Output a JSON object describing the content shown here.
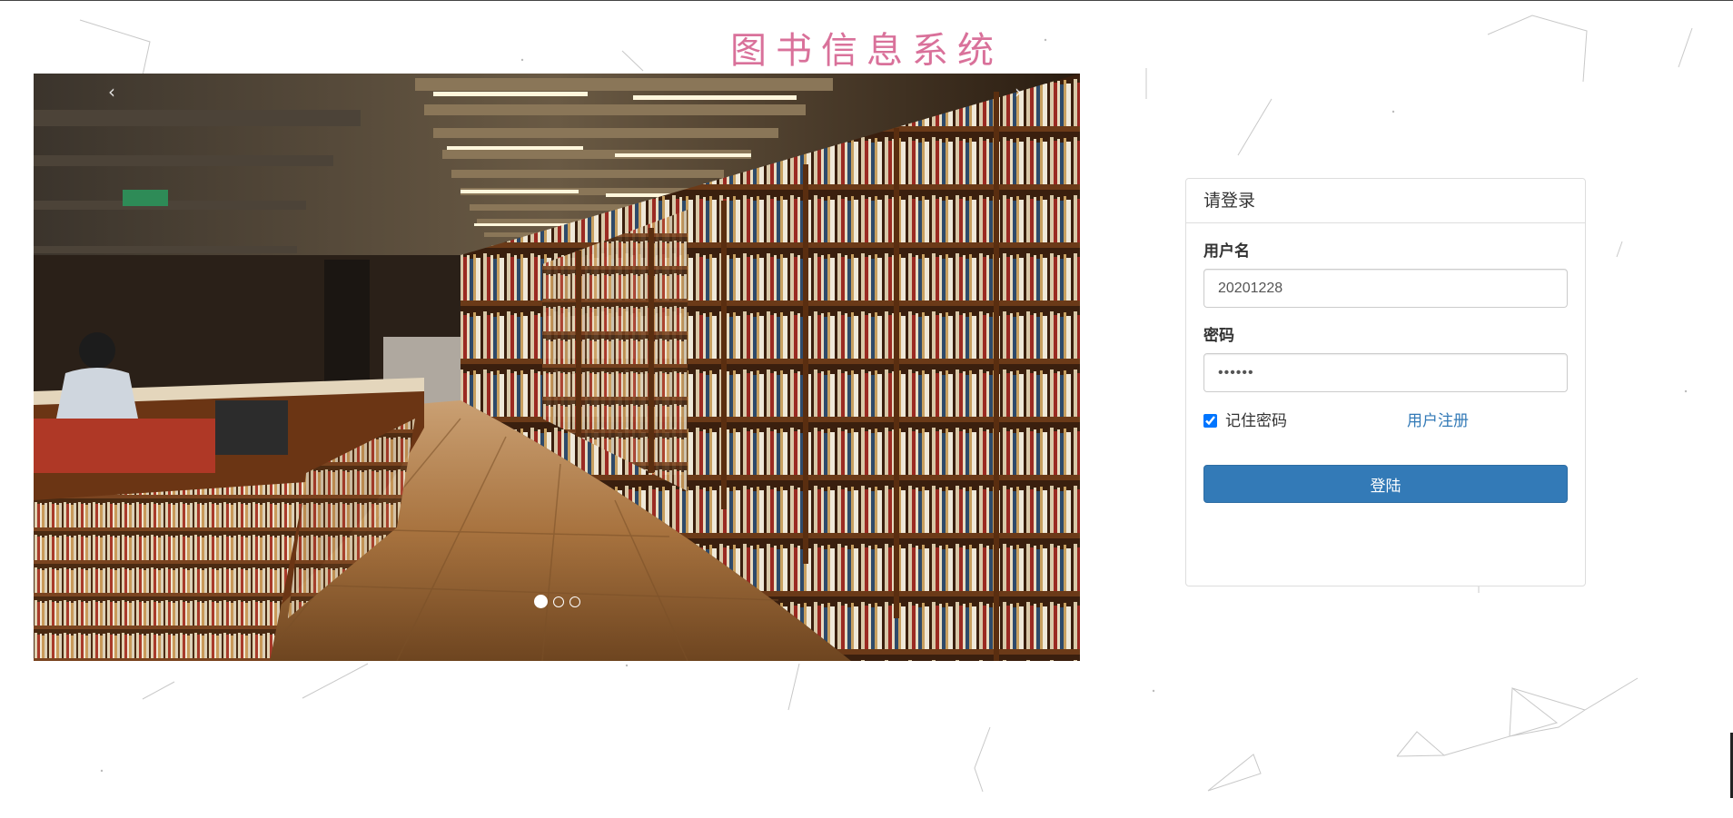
{
  "header": {
    "title": "图书信息系统"
  },
  "carousel": {
    "prev_label": "‹",
    "next_label": "›",
    "slide_count": 3,
    "active_index": 0,
    "image_alt": "bookstore-interior"
  },
  "login": {
    "heading": "请登录",
    "username_label": "用户名",
    "username_value": "20201228",
    "password_label": "密码",
    "password_value": "123456",
    "remember_label": "记住密码",
    "remember_checked": true,
    "register_link": "用户注册",
    "submit_label": "登陆"
  },
  "colors": {
    "title": "#d9719a",
    "primary": "#337ab7",
    "link": "#337ab7",
    "border": "#dddddd"
  }
}
